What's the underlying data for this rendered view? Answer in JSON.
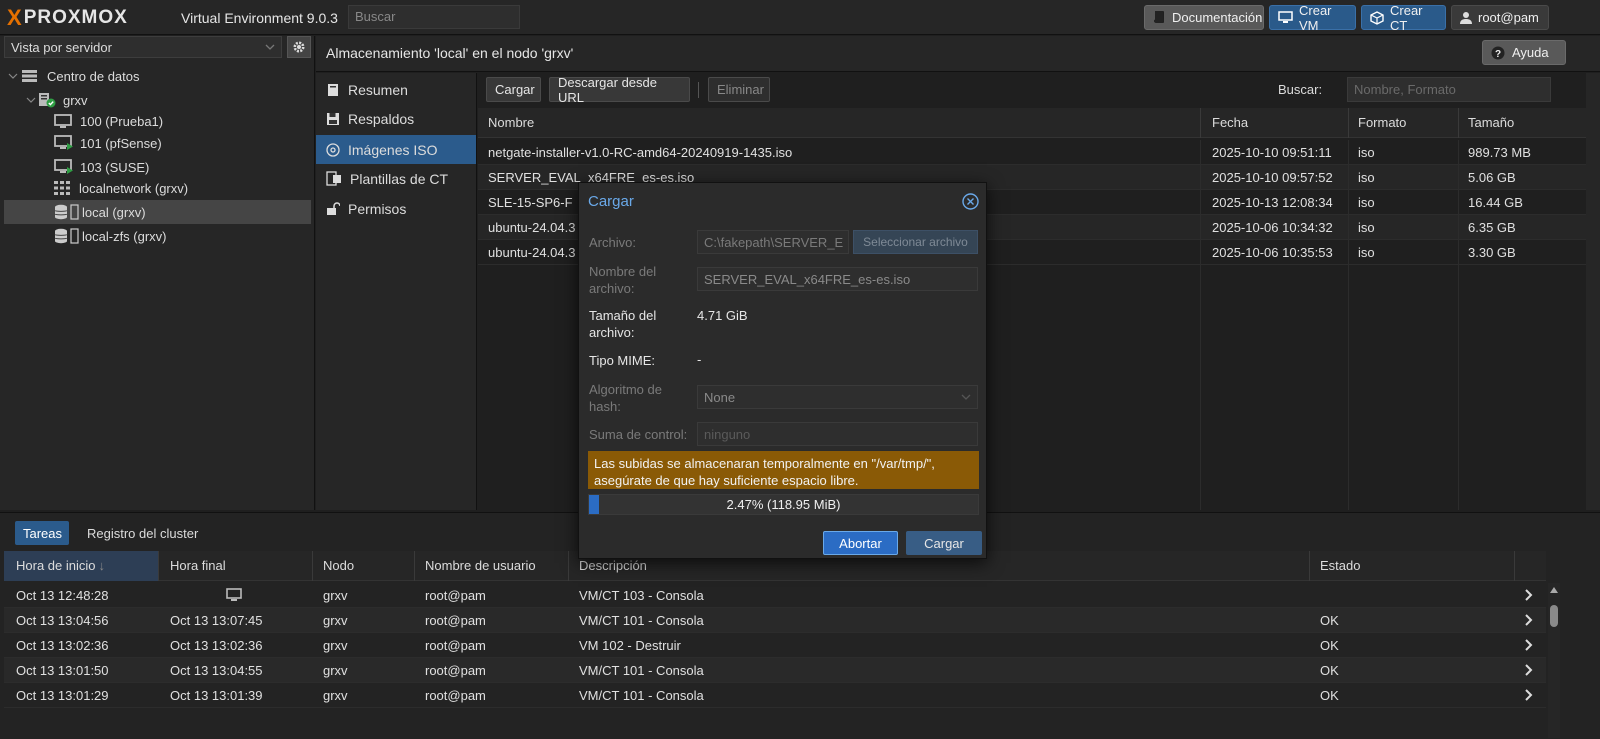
{
  "topbar": {
    "logo_x_left": "X",
    "logo_text": "PROXMOX",
    "logo_x_right": "X",
    "product": "Virtual Environment 9.0.3",
    "search_placeholder": "Buscar",
    "docs_label": "Documentación",
    "create_vm_label": "Crear VM",
    "create_ct_label": "Crear CT",
    "user_label": "root@pam"
  },
  "sidebar": {
    "view_label": "Vista por servidor",
    "tree": [
      {
        "label": "Centro de datos",
        "icon": "datacenter-icon"
      },
      {
        "label": "grxv",
        "icon": "node-icon"
      },
      {
        "label": "100 (Prueba1)",
        "icon": "vm-stopped-icon"
      },
      {
        "label": "101 (pfSense)",
        "icon": "vm-running-icon"
      },
      {
        "label": "103 (SUSE)",
        "icon": "vm-running-icon"
      },
      {
        "label": "localnetwork (grxv)",
        "icon": "network-icon"
      },
      {
        "label": "local (grxv)",
        "icon": "storage-icon"
      },
      {
        "label": "local-zfs (grxv)",
        "icon": "storage-icon"
      }
    ]
  },
  "main": {
    "title": "Almacenamiento 'local' en el nodo 'grxv'",
    "help_label": "Ayuda"
  },
  "storage_nav": {
    "items": [
      {
        "label": "Resumen",
        "icon": "book-icon"
      },
      {
        "label": "Respaldos",
        "icon": "floppy-icon"
      },
      {
        "label": "Imágenes ISO",
        "icon": "disc-icon"
      },
      {
        "label": "Plantillas de CT",
        "icon": "template-icon"
      },
      {
        "label": "Permisos",
        "icon": "unlock-icon"
      }
    ]
  },
  "toolbar": {
    "upload_label": "Cargar",
    "download_url_label": "Descargar desde URL",
    "delete_label": "Eliminar",
    "search_label": "Buscar:",
    "search_placeholder": "Nombre, Formato"
  },
  "iso_table": {
    "columns": [
      "Nombre",
      "Fecha",
      "Formato",
      "Tamaño"
    ],
    "rows": [
      {
        "name": "netgate-installer-v1.0-RC-amd64-20240919-1435.iso",
        "date": "2025-10-10 09:51:11",
        "format": "iso",
        "size": "989.73 MB"
      },
      {
        "name": "SERVER_EVAL_x64FRE_es-es.iso",
        "date": "2025-10-10 09:57:52",
        "format": "iso",
        "size": "5.06 GB"
      },
      {
        "name": "SLE-15-SP6-F",
        "date": "2025-10-13 12:08:34",
        "format": "iso",
        "size": "16.44 GB"
      },
      {
        "name": "ubuntu-24.04.3",
        "date": "2025-10-06 10:34:32",
        "format": "iso",
        "size": "6.35 GB"
      },
      {
        "name": "ubuntu-24.04.3",
        "date": "2025-10-06 10:35:53",
        "format": "iso",
        "size": "3.30 GB"
      }
    ]
  },
  "modal": {
    "title": "Cargar",
    "file_label": "Archivo:",
    "file_value": "C:\\fakepath\\SERVER_E",
    "select_file_label": "Seleccionar archivo",
    "filename_label": "Nombre del archivo:",
    "filename_value": "SERVER_EVAL_x64FRE_es-es.iso",
    "size_label": "Tamaño del archivo:",
    "size_value": "4.71 GiB",
    "mime_label": "Tipo MIME:",
    "mime_value": "-",
    "hash_label": "Algoritmo de hash:",
    "hash_value": "None",
    "checksum_label": "Suma de control:",
    "checksum_placeholder": "ninguno",
    "warning": "Las subidas se almacenaran temporalmente en \"/var/tmp/\", asegúrate de que hay suficiente espacio libre.",
    "progress_text": "2.47% (118.95 MiB)",
    "progress_fraction": 0.0247,
    "abort_label": "Abortar",
    "upload_label": "Cargar"
  },
  "tasks": {
    "tabs": [
      "Tareas",
      "Registro del cluster"
    ],
    "columns": [
      "Hora de inicio",
      "Hora final",
      "Nodo",
      "Nombre de usuario",
      "Descripción",
      "Estado"
    ],
    "sort_arrow": "↓",
    "rows": [
      {
        "start": "Oct 13 12:48:28",
        "end": "",
        "node": "grxv",
        "user": "root@pam",
        "desc": "VM/CT 103 - Consola",
        "status": ""
      },
      {
        "start": "Oct 13 13:04:56",
        "end": "Oct 13 13:07:45",
        "node": "grxv",
        "user": "root@pam",
        "desc": "VM/CT 101 - Consola",
        "status": "OK"
      },
      {
        "start": "Oct 13 13:02:36",
        "end": "Oct 13 13:02:36",
        "node": "grxv",
        "user": "root@pam",
        "desc": "VM 102 - Destruir",
        "status": "OK"
      },
      {
        "start": "Oct 13 13:01:50",
        "end": "Oct 13 13:04:55",
        "node": "grxv",
        "user": "root@pam",
        "desc": "VM/CT 101 - Consola",
        "status": "OK"
      },
      {
        "start": "Oct 13 13:01:29",
        "end": "Oct 13 13:01:39",
        "node": "grxv",
        "user": "root@pam",
        "desc": "VM/CT 101 - Consola",
        "status": "OK"
      }
    ]
  },
  "colors": {
    "accent": "#2b5b8c",
    "brand_orange": "#e57000",
    "warning_bg": "#8a5a06",
    "progress_fill": "#2b6cc4"
  }
}
